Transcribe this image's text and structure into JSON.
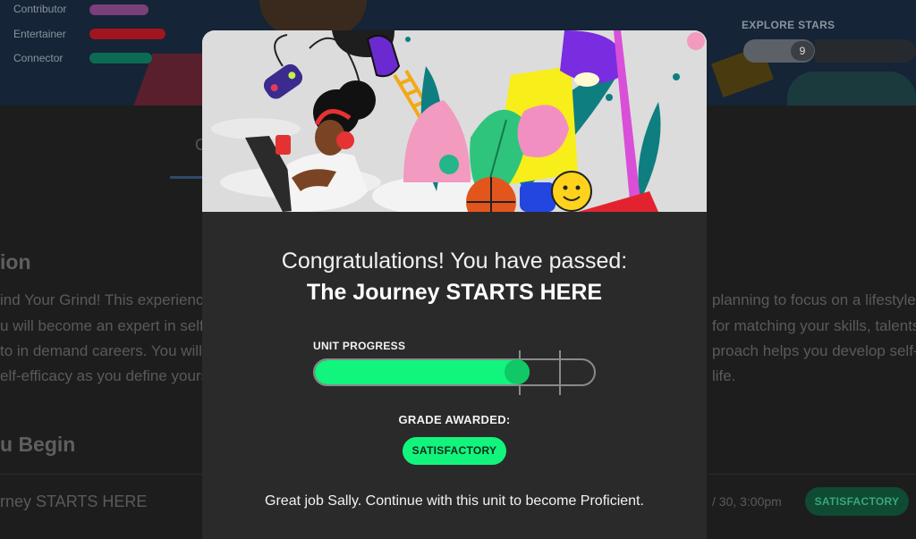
{
  "background": {
    "traits": [
      {
        "label": "Contributor",
        "color": "#7b3f7a"
      },
      {
        "label": "Entertainer",
        "color": "#a0151f"
      },
      {
        "label": "Connector",
        "color": "#0d6b55"
      }
    ],
    "explore": {
      "label": "EXPLORE STARS",
      "value": "9"
    },
    "tab_fragment": "C",
    "section_heading": "ion",
    "description_lines": [
      "ind Your Grind! This experience",
      "u will become an expert in self-",
      "to in demand careers. You will",
      "elf-efficacy as you define yourse"
    ],
    "description_lines_right": [
      "planning to focus on a lifestyle-f",
      "for matching your skills, talents",
      "proach helps you develop self-e",
      "life."
    ],
    "before_heading": "u Begin",
    "unit_row": {
      "title": "rney STARTS HERE",
      "date": "/ 30, 3:00pm",
      "status": "SATISFACTORY"
    }
  },
  "modal": {
    "congrats_text": "Congratulations! You have passed:",
    "unit_title": "The Journey STARTS HERE",
    "progress": {
      "label": "UNIT PROGRESS",
      "value": 0.77
    },
    "grade": {
      "label": "GRADE AWARDED:",
      "value": "SATISFACTORY"
    },
    "message": "Great job Sally. Continue with this unit to become Proficient."
  },
  "colors": {
    "progress_green": "#12f57d",
    "modal_bg": "#2a2a2a"
  }
}
